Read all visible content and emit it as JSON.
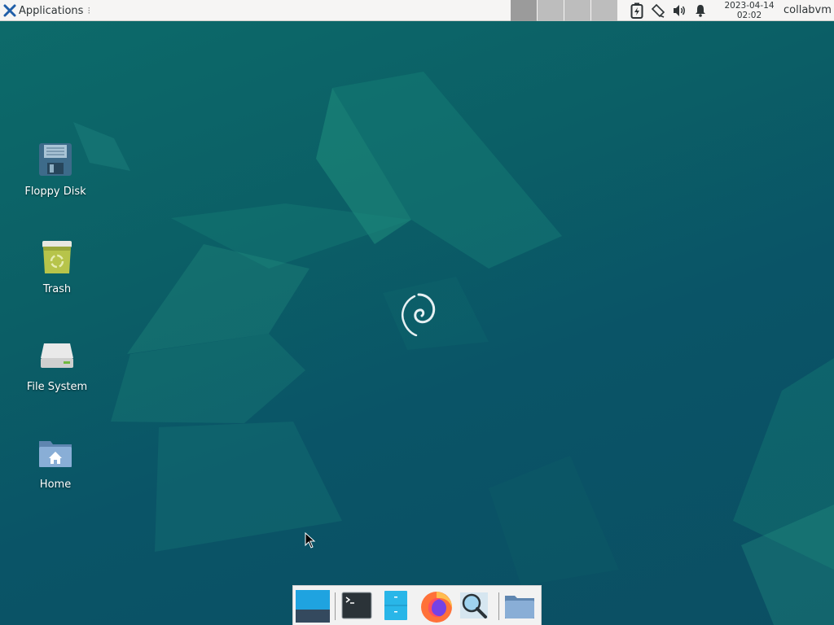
{
  "top_panel": {
    "applications_label": "Applications",
    "applications_separator": "⁝",
    "workspaces_count": 4,
    "active_workspace": 1,
    "clock": {
      "date": "2023-04-14",
      "time": "02:02"
    },
    "user": "collabvm",
    "tray_icons": [
      "power-manager-icon",
      "network-icon",
      "volume-icon",
      "notification-bell-icon"
    ]
  },
  "desktop": {
    "icons": [
      {
        "label": "Floppy Disk",
        "icon": "floppy-disk-icon"
      },
      {
        "label": "Trash",
        "icon": "trash-icon"
      },
      {
        "label": "File System",
        "icon": "file-system-drive-icon"
      },
      {
        "label": "Home",
        "icon": "home-folder-icon"
      }
    ],
    "wallpaper_logo": "debian-swirl-logo"
  },
  "dock": {
    "items": [
      {
        "name": "show-desktop",
        "icon": "show-desktop-icon"
      },
      {
        "name": "terminal",
        "icon": "terminal-icon"
      },
      {
        "name": "file-manager",
        "icon": "file-manager-icon"
      },
      {
        "name": "firefox",
        "icon": "firefox-icon"
      },
      {
        "name": "app-finder",
        "icon": "magnifier-search-icon"
      },
      {
        "name": "files-folder",
        "icon": "folder-icon"
      }
    ]
  },
  "colors": {
    "panel_bg": "#f6f5f4",
    "desktop_teal": "#0b5f66",
    "accent_blue": "#1fa3e0"
  }
}
